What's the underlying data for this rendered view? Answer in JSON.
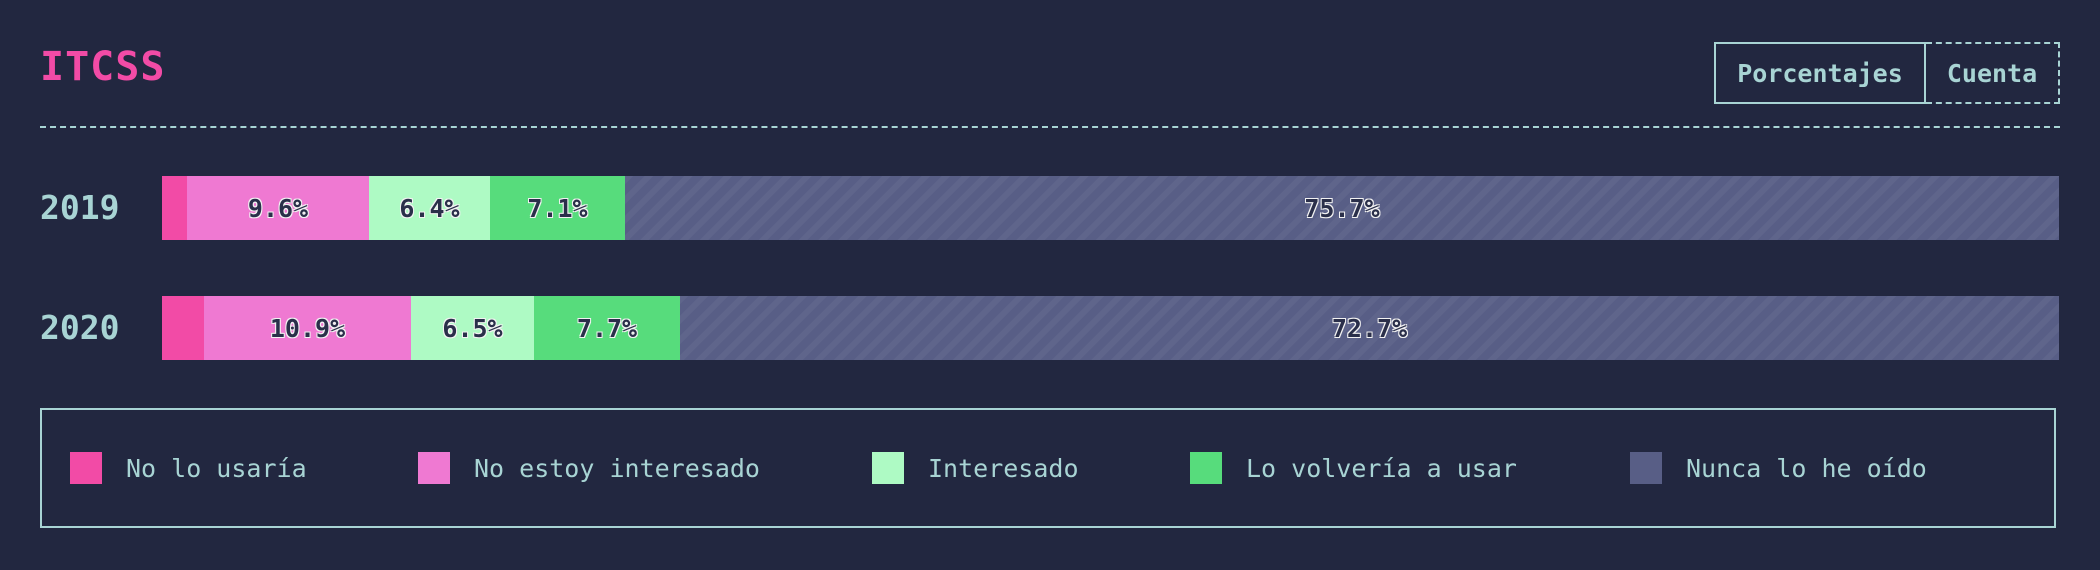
{
  "title": "ITCSS",
  "toggle": {
    "percent_label": "Porcentajes",
    "count_label": "Cuenta",
    "selected": "Porcentajes"
  },
  "chart_data": {
    "type": "bar",
    "orientation": "horizontal",
    "stacked": true,
    "categories": [
      "2019",
      "2020"
    ],
    "series": [
      {
        "name": "No lo usaría",
        "color": "#f24ba6",
        "values": [
          1.3,
          2.2
        ],
        "labels": [
          "",
          ""
        ]
      },
      {
        "name": "No estoy interesado",
        "color": "#ef79d2",
        "values": [
          9.6,
          10.9
        ],
        "labels": [
          "9.6%",
          "10.9%"
        ]
      },
      {
        "name": "Interesado",
        "color": "#aefac4",
        "values": [
          6.4,
          6.5
        ],
        "labels": [
          "6.4%",
          "6.5%"
        ]
      },
      {
        "name": "Lo volvería a usar",
        "color": "#57dc7c",
        "values": [
          7.1,
          7.7
        ],
        "labels": [
          "7.1%",
          "7.7%"
        ]
      },
      {
        "name": "Nunca lo he oído",
        "color": "#585e86",
        "values": [
          75.7,
          72.7
        ],
        "labels": [
          "75.7%",
          "72.7%"
        ],
        "hatched": true
      }
    ],
    "xlim": [
      0,
      100
    ]
  }
}
